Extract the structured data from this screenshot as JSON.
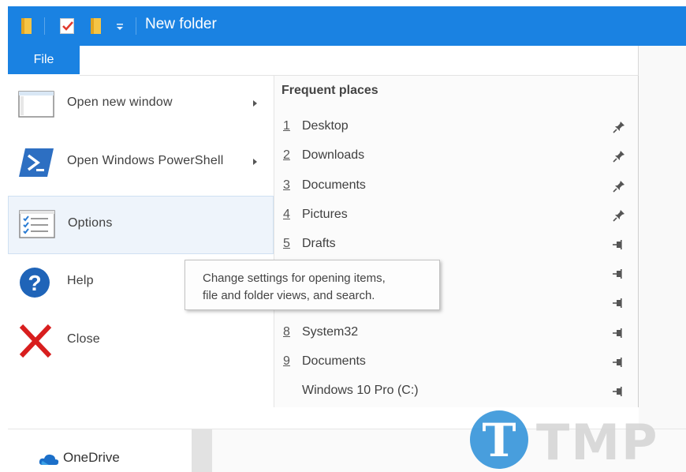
{
  "titlebar": {
    "title": "New folder",
    "accent": "#1a82e2"
  },
  "ribbon": {
    "file_tab": "File"
  },
  "file_menu": {
    "items": [
      {
        "label": "Open new window",
        "icon": "window-icon",
        "has_submenu": true
      },
      {
        "label": "Open Windows PowerShell",
        "icon": "powershell-icon",
        "has_submenu": true
      },
      {
        "label": "Options",
        "icon": "options-icon",
        "has_submenu": false,
        "selected": true
      },
      {
        "label": "Help",
        "icon": "help-icon",
        "has_submenu": false
      },
      {
        "label": "Close",
        "icon": "close-icon",
        "has_submenu": false
      }
    ]
  },
  "frequent_places": {
    "heading": "Frequent places",
    "items": [
      {
        "num": "1",
        "name": "Desktop",
        "pinned": true
      },
      {
        "num": "2",
        "name": "Downloads",
        "pinned": true
      },
      {
        "num": "3",
        "name": "Documents",
        "pinned": true
      },
      {
        "num": "4",
        "name": "Pictures",
        "pinned": true
      },
      {
        "num": "5",
        "name": "Drafts",
        "pinned": false
      },
      {
        "num": "6",
        "name": "",
        "pinned": false
      },
      {
        "num": "7",
        "name": "",
        "pinned": false
      },
      {
        "num": "8",
        "name": "System32",
        "pinned": false
      },
      {
        "num": "9",
        "name": "Documents",
        "pinned": false
      },
      {
        "num": "",
        "name": "Windows 10 Pro (C:)",
        "pinned": false
      }
    ]
  },
  "tooltip": {
    "line1": "Change settings for opening items,",
    "line2": "file and folder views, and search."
  },
  "navigation": {
    "onedrive_label": "OneDrive"
  },
  "watermark": {
    "letter": "T",
    "text": "TMP"
  }
}
